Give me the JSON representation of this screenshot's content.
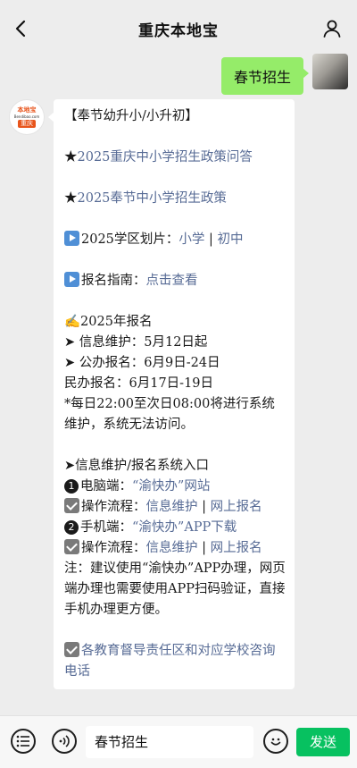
{
  "header": {
    "title": "重庆本地宝"
  },
  "outgoing": {
    "text": "春节招生"
  },
  "bot": {
    "logo_top": "本地宝",
    "logo_mid": "Bendibao.com",
    "logo_city": "重庆"
  },
  "reply": {
    "heading": "【奉节幼升小/小升初】",
    "star": "★",
    "link1": "2025重庆中小学招生政策问答",
    "link2": "2025奉节中小学招生政策",
    "district_prefix": "2025学区划片：",
    "district_primary": "小学",
    "district_sep": " | ",
    "district_middle": "初中",
    "guide_prefix": "报名指南：",
    "guide_link": "点击查看",
    "reg_heading": "✍2025年报名",
    "info_maint": "➤ 信息维护：5月12日起",
    "public_reg": "➤ 公办报名：6月9日-24日",
    "private_reg": "民办报名：6月17日-19日",
    "maint_note": "*每日22:00至次日08:00将进行系统维护，系统无法访问。",
    "entry_heading": "➤信息维护/报名系统入口",
    "pc_num": "1",
    "pc_prefix": "电脑端：",
    "pc_link": "“渝快办”网站",
    "op_prefix": "操作流程：",
    "op_link1": "信息维护",
    "op_sep": " | ",
    "op_link2": "网上报名",
    "mobile_num": "2",
    "mobile_prefix": "手机端：",
    "mobile_link": "“渝快办”APP下载",
    "op2_prefix": "操作流程：",
    "op2_link1": "信息维护",
    "op2_sep": " | ",
    "op2_link2": "网上报名",
    "note": "注：建议使用“渝快办”APP办理，网页端办理也需要使用APP扫码验证，直接手机办理更方便。",
    "contact_link": "各教育督导责任区和对应学校咨询电话"
  },
  "input": {
    "value": "春节招生",
    "send_label": "发送"
  },
  "colors": {
    "background": "#ededed",
    "outgoing_bubble": "#95ec69",
    "link": "#576b95",
    "send_button": "#07c160"
  },
  "icons": [
    "back-arrow-icon",
    "profile-icon",
    "menu-list-icon",
    "voice-icon",
    "emoji-icon",
    "play-icon",
    "checkbox-icon"
  ]
}
